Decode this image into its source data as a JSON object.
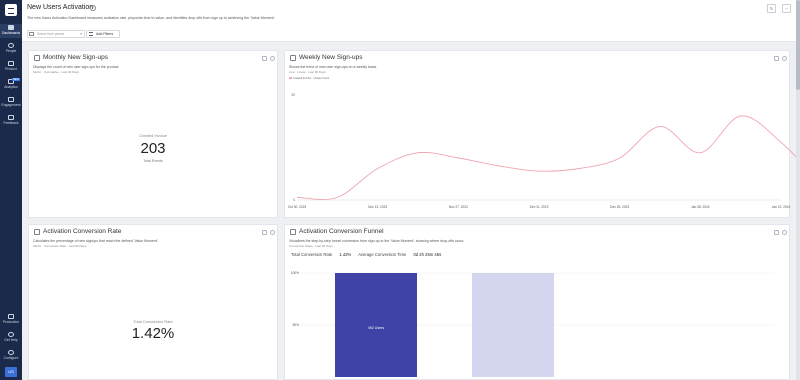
{
  "sidebar": {
    "items": [
      {
        "label": "Dashboards",
        "active": true
      },
      {
        "label": "People"
      },
      {
        "label": "Product"
      },
      {
        "label": "Analytics",
        "badge": "NEW"
      },
      {
        "label": "Engagement"
      },
      {
        "label": "Feedback"
      }
    ],
    "bottom_items": [
      {
        "label": "Production"
      },
      {
        "label": "Get Help"
      },
      {
        "label": "Configure"
      }
    ],
    "avatar": "US"
  },
  "header": {
    "title": "New Users Activation",
    "description": "The new Users Activation Dashboard measures activation rate, pinpoints time to value, and identifies drop offs from sign up to achieving the 'Value Moment'.",
    "period_placeholder": "Select time period",
    "add_filters_label": "Add Filters"
  },
  "cards": {
    "monthly": {
      "title": "Monthly New Sign-ups",
      "description": "Displays the count of new user sign-ups for the product.",
      "meta": "Metric · Cumulative · Last 30 Days",
      "kpi_label": "Created Invoice",
      "kpi_value": "203",
      "kpi_sub": "Total Events"
    },
    "weekly": {
      "title": "Weekly New Sign-ups",
      "description": "Shows the trend of new user sign-ups on a weekly basis.",
      "meta": "Line · Linear · Last 90 Days",
      "legend": "Created Invoice · Unique Users"
    },
    "conversion": {
      "title": "Activation Conversion Rate",
      "description": "Calculates the percentage of new signups that reach the defined 'Value Moment'.",
      "meta": "Metric · Conversion Rate · Last 90 Days",
      "kpi_label": "Total Conversion Rate",
      "kpi_value": "1.42%"
    },
    "funnel": {
      "title": "Activation Conversion Funnel",
      "description": "Visualizes the step-by-step funnel conversion from sign-up to the 'Value Moment', showing where drop-offs occur.",
      "meta": "Conversion Steps · Last 90 Days",
      "total_label": "Total Conversion Rate",
      "total_value": "1.42%",
      "avg_label": "Average Conversion Time",
      "avg_value": "0d 2h 25m 46s",
      "bar_label": "492 Users",
      "y_ticks": [
        "100%",
        "50%"
      ],
      "bars": [
        {
          "value": 100,
          "color": "#3f43a8"
        },
        {
          "value": 100,
          "color": "#d4d5ef"
        }
      ]
    }
  },
  "chart_data": {
    "type": "line",
    "x_ticks": [
      "Oct 30, 2023",
      "Nov 13, 2023",
      "Nov 27, 2023",
      "Dec 11, 2023",
      "Dec 25, 2023",
      "Jan 08, 2024",
      "Jan 22, 2024"
    ],
    "y_ticks": [
      "20",
      "0"
    ],
    "ylim": [
      0,
      20
    ],
    "series": [
      {
        "name": "Created Invoice · Unique Users",
        "color": "#f2a5b2",
        "x": [
          0,
          0.5,
          1,
          1.5,
          2,
          2.5,
          3,
          3.5,
          4,
          4.5,
          5,
          5.5,
          6,
          6.5
        ],
        "values": [
          0.5,
          0.5,
          6,
          9,
          8,
          6.5,
          5.5,
          6,
          8,
          14,
          9,
          16,
          11,
          3
        ]
      }
    ]
  }
}
